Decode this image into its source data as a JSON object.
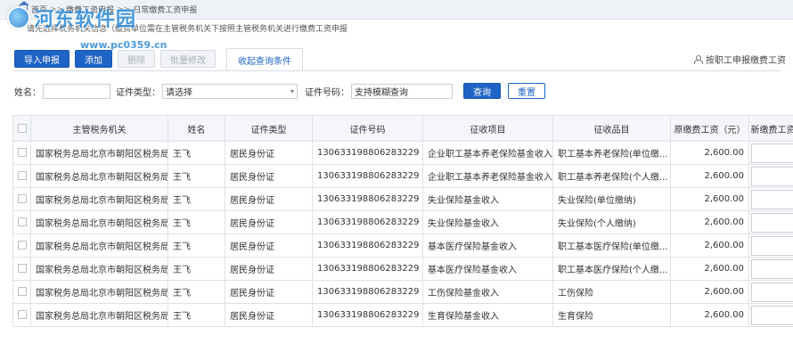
{
  "breadcrumb": {
    "home": "首页",
    "level1": "缴费工资申报",
    "level2": "日常缴费工资申报"
  },
  "watermark": {
    "logo_text": "河东软件园",
    "url": "www.pc0359.cn"
  },
  "notice": "请先选择税务机关信息（缴费单位需在主管税务机关下按照主管税务机关进行缴费工资申报",
  "toolbar": {
    "import_label": "导入申报",
    "add_label": "添加",
    "delete_label": "删除",
    "batch_edit_label": "批量修改"
  },
  "tab": {
    "collapse_label": "收起查询条件"
  },
  "right_link": {
    "label": "按职工申报缴费工资"
  },
  "filter": {
    "name_label": "姓名：",
    "name_value": "",
    "id_type_label": "证件类型：",
    "id_type_value": "请选择",
    "id_no_label": "证件号码：",
    "id_no_value": "支持模糊查询",
    "query_label": "查询",
    "reset_label": "重置"
  },
  "table": {
    "headers": [
      "主管税务机关",
      "姓名",
      "证件类型",
      "证件号码",
      "征收项目",
      "征收品目",
      "原缴费工资（元）",
      "新缴费工资"
    ],
    "rows": [
      [
        "国家税务总局北京市朝阳区税务局",
        "王飞",
        "居民身份证",
        "130633198806283229",
        "企业职工基本养老保险基金收入",
        "职工基本养老保险(单位缴...",
        "2,600.00"
      ],
      [
        "国家税务总局北京市朝阳区税务局",
        "王飞",
        "居民身份证",
        "130633198806283229",
        "企业职工基本养老保险基金收入",
        "职工基本养老保险(个人缴...",
        "2,600.00"
      ],
      [
        "国家税务总局北京市朝阳区税务局",
        "王飞",
        "居民身份证",
        "130633198806283229",
        "失业保险基金收入",
        "失业保险(单位缴纳)",
        "2,600.00"
      ],
      [
        "国家税务总局北京市朝阳区税务局",
        "王飞",
        "居民身份证",
        "130633198806283229",
        "失业保险基金收入",
        "失业保险(个人缴纳)",
        "2,600.00"
      ],
      [
        "国家税务总局北京市朝阳区税务局",
        "王飞",
        "居民身份证",
        "130633198806283229",
        "基本医疗保险基金收入",
        "职工基本医疗保险(单位缴...",
        "2,600.00"
      ],
      [
        "国家税务总局北京市朝阳区税务局",
        "王飞",
        "居民身份证",
        "130633198806283229",
        "基本医疗保险基金收入",
        "职工基本医疗保险(个人缴...",
        "2,600.00"
      ],
      [
        "国家税务总局北京市朝阳区税务局",
        "王飞",
        "居民身份证",
        "130633198806283229",
        "工伤保险基金收入",
        "工伤保险",
        "2,600.00"
      ],
      [
        "国家税务总局北京市朝阳区税务局",
        "王飞",
        "居民身份证",
        "130633198806283229",
        "生育保险基金收入",
        "生育保险",
        "2,600.00"
      ]
    ]
  },
  "colors": {
    "primary": "#1e63c6",
    "header_bg": "#f4f6f9",
    "border": "#dde2e8"
  }
}
